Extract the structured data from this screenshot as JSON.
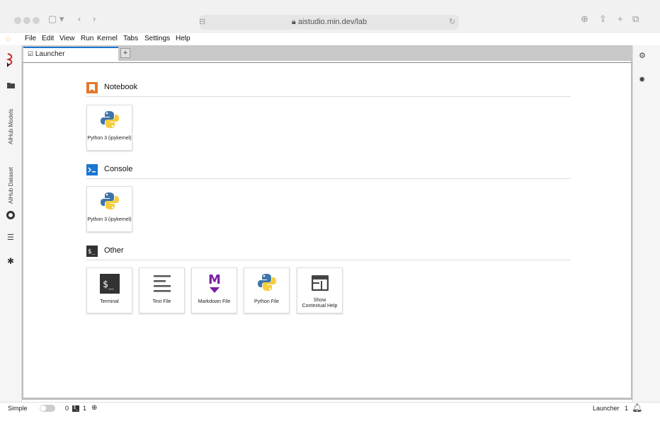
{
  "browser": {
    "url": "aistudio.min.dev/lab"
  },
  "menubar": {
    "items": [
      "File",
      "Edit",
      "View",
      "Run",
      "Kernel",
      "Tabs",
      "Settings",
      "Help"
    ]
  },
  "tabs": {
    "active_label": "Launcher",
    "new_tab": "+"
  },
  "sidebar": {
    "vertical_tabs": [
      "AIHub Models",
      "AIHub Dataset"
    ]
  },
  "sections": {
    "notebook": {
      "title": "Notebook",
      "cards": [
        {
          "label": "Python 3 (ipykernel)"
        }
      ]
    },
    "console": {
      "title": "Console",
      "cards": [
        {
          "label": "Python 3 (ipykernel)"
        }
      ]
    },
    "other": {
      "title": "Other",
      "cards": [
        {
          "label": "Terminal"
        },
        {
          "label": "Text File"
        },
        {
          "label": "Markdown File"
        },
        {
          "label": "Python File"
        },
        {
          "label": "Show Contextual Help"
        }
      ]
    }
  },
  "statusbar": {
    "mode": "Simple",
    "terminals": "0",
    "kernels": "1",
    "right_label": "Launcher",
    "right_count": "1"
  },
  "colors": {
    "accent": "#1976d2",
    "notebook_icon": "#e5772b",
    "console_icon": "#1976d2",
    "markdown": "#7b1fa2",
    "terminal": "#333333",
    "python_blue": "#3f75a8",
    "python_yellow": "#f5cc3c"
  }
}
